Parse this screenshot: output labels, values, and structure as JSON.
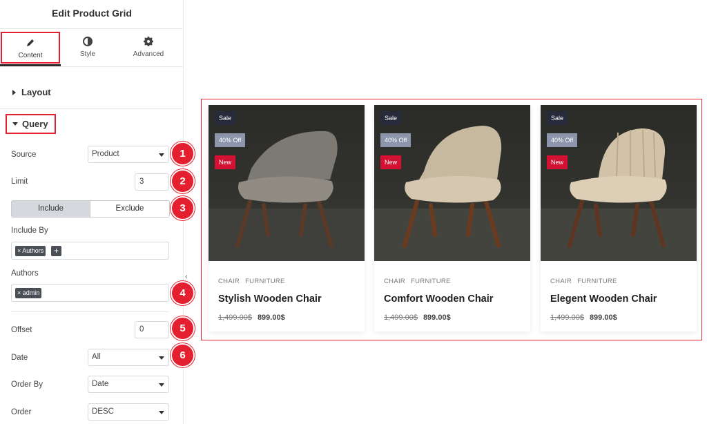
{
  "panel": {
    "title": "Edit Product Grid",
    "tabs": [
      {
        "label": "Content",
        "icon": "pencil-icon"
      },
      {
        "label": "Style",
        "icon": "half-circle-icon"
      },
      {
        "label": "Advanced",
        "icon": "gear-icon"
      }
    ],
    "sections": {
      "layout": "Layout",
      "query": "Query"
    },
    "fields": {
      "source": {
        "label": "Source",
        "value": "Product"
      },
      "limit": {
        "label": "Limit",
        "value": "3"
      },
      "include_exclude": {
        "include": "Include",
        "exclude": "Exclude",
        "selected": "Include"
      },
      "include_by": {
        "label": "Include By",
        "tags": [
          "× Authors"
        ],
        "add": "+"
      },
      "authors": {
        "label": "Authors",
        "tags": [
          "× admin"
        ]
      },
      "offset": {
        "label": "Offset",
        "value": "0"
      },
      "date": {
        "label": "Date",
        "value": "All"
      },
      "order_by": {
        "label": "Order By",
        "value": "Date"
      },
      "order": {
        "label": "Order",
        "value": "DESC"
      }
    },
    "collapse_icon": "‹",
    "callouts": [
      "1",
      "2",
      "3",
      "4",
      "5",
      "6"
    ]
  },
  "products": [
    {
      "badges": {
        "sale": "Sale",
        "off": "40% Off",
        "new": "New"
      },
      "categories": [
        "CHAIR",
        "FURNITURE"
      ],
      "title": "Stylish Wooden Chair",
      "old_price": "1,499.00$",
      "price": "899.00$"
    },
    {
      "badges": {
        "sale": "Sale",
        "off": "40% Off",
        "new": "New"
      },
      "categories": [
        "CHAIR",
        "FURNITURE"
      ],
      "title": "Comfort Wooden Chair",
      "old_price": "1,499.00$",
      "price": "899.00$"
    },
    {
      "badges": {
        "sale": "Sale",
        "off": "40% Off",
        "new": "New"
      },
      "categories": [
        "CHAIR",
        "FURNITURE"
      ],
      "title": "Elegent Wooden Chair",
      "old_price": "1,499.00$",
      "price": "899.00$"
    }
  ],
  "colors": {
    "accent": "#e41f2f",
    "sale": "#272a3a",
    "off": "#8d95ac",
    "new": "#d41133"
  }
}
